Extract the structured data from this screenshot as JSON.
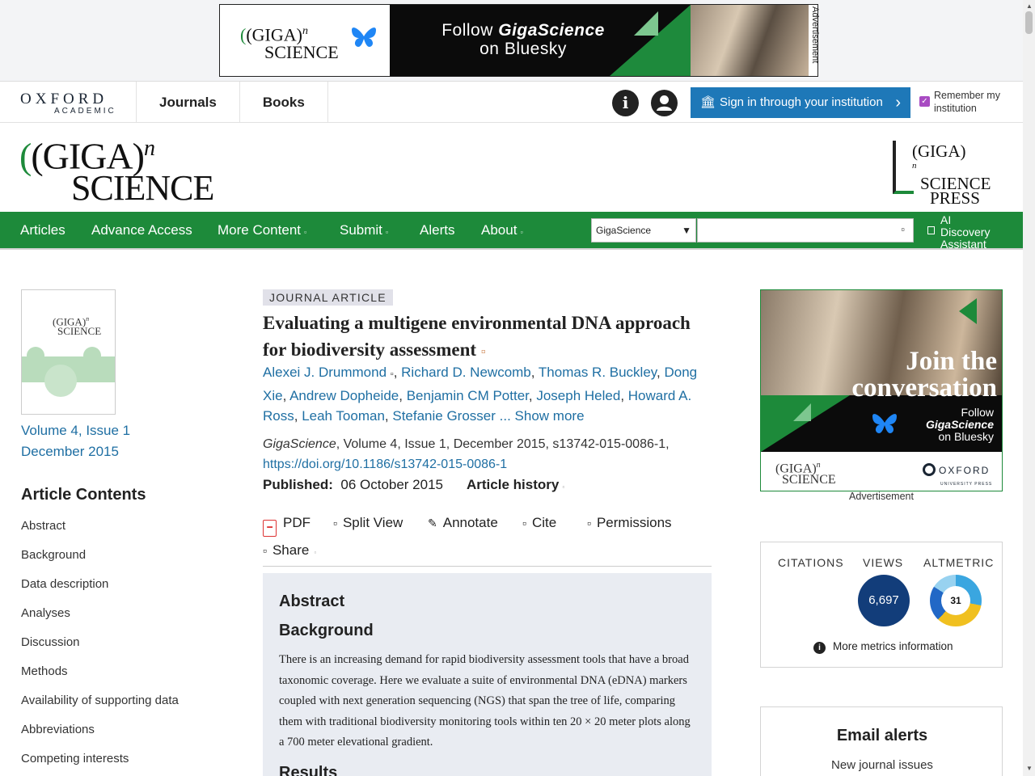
{
  "top_ad": {
    "logo_line1": "(GIGA)",
    "logo_sup": "n",
    "logo_line2": "SCIENCE",
    "text_line1": "Follow ",
    "text_brand": "GigaScience",
    "text_line2": "on Bluesky",
    "label": "Advertisement"
  },
  "oxford_header": {
    "logo_line1": "OXFORD",
    "logo_line2": "ACADEMIC",
    "nav": [
      "Journals",
      "Books"
    ],
    "info_icon": "info-icon",
    "account_icon": "account-icon",
    "signin_label": "Sign in through your institution",
    "remember_label": "Remember my institution",
    "remember_checked": true
  },
  "journal_brand": {
    "logo_line1": "(GIGA)",
    "logo_sup": "n",
    "logo_line2": "SCIENCE",
    "press_line1": "(GIGA)",
    "press_sup": "n",
    "press_line2": "SCIENCE",
    "press_line3": "PRESS"
  },
  "journal_nav": {
    "items": [
      "Articles",
      "Advance Access",
      "More Content",
      "Submit",
      "Alerts",
      "About"
    ],
    "search_scope": "GigaScience",
    "search_value": "",
    "ai_label_line1": "AI",
    "ai_label_line2": "Discovery",
    "ai_label_line3": "Assistant"
  },
  "sidebar": {
    "cover_line1": "(GIGA)",
    "cover_sup": "n",
    "cover_line2": "SCIENCE",
    "volume_issue": "Volume 4, Issue 1",
    "issue_date": "December 2015",
    "contents_title": "Article Contents",
    "contents": [
      "Abstract",
      "Background",
      "Data description",
      "Analyses",
      "Discussion",
      "Methods",
      "Availability of supporting data",
      "Abbreviations",
      "Competing interests"
    ]
  },
  "article": {
    "type_badge": "JOURNAL ARTICLE",
    "title": "Evaluating a multigene environmental DNA approach for biodiversity assessment",
    "authors": [
      "Alexei J. Drummond",
      "Richard D. Newcomb",
      "Thomas R. Buckley",
      "Dong Xie",
      "Andrew Dopheide",
      "Benjamin CM Potter",
      "Joseph Heled",
      "Howard A. Ross",
      "Leah Tooman",
      "Stefanie Grosser"
    ],
    "authors_more": "... Show more",
    "journal": "GigaScience",
    "citation": ", Volume 4, Issue 1, December 2015, s13742-015-0086-1,",
    "doi": "https://doi.org/10.1186/s13742-015-0086-1",
    "published_label": "Published:",
    "published_date": "06 October 2015",
    "history_label": "Article history",
    "tools": {
      "pdf": "PDF",
      "split_view": "Split View",
      "annotate": "Annotate",
      "cite": "Cite",
      "permissions": "Permissions",
      "share": "Share"
    },
    "abstract_heading": "Abstract",
    "background_heading": "Background",
    "background_text": "There is an increasing demand for rapid biodiversity assessment tools that have a broad taxonomic coverage. Here we evaluate a suite of environmental DNA (eDNA) markers coupled with next generation sequencing (NGS) that span the tree of life, comparing them with traditional biodiversity monitoring tools within ten 20 × 20 meter plots along a 700 meter elevational gradient.",
    "results_heading": "Results"
  },
  "right_ad": {
    "headline_line1": "Join the",
    "headline_line2": "conversation",
    "follow_line1": "Follow",
    "follow_brand": "GigaScience",
    "follow_line3": "on Bluesky",
    "logo_line1": "(GIGA)",
    "logo_sup": "n",
    "logo_line2": "SCIENCE",
    "oxford_line1": "OXFORD",
    "oxford_line2": "UNIVERSITY PRESS",
    "label": "Advertisement"
  },
  "metrics": {
    "citations_label": "CITATIONS",
    "views_label": "VIEWS",
    "views_value": "6,697",
    "altmetric_label": "ALTMETRIC",
    "altmetric_value": "31",
    "more_label": "More metrics information"
  },
  "email_alerts": {
    "title": "Email alerts",
    "subtitle": "New journal issues"
  },
  "colors": {
    "brand_green": "#1d8a3a",
    "link_blue": "#1f6fa3",
    "signin_blue": "#1e78b8",
    "views_navy": "#123d7a",
    "bluesky_blue": "#1f86f5"
  }
}
